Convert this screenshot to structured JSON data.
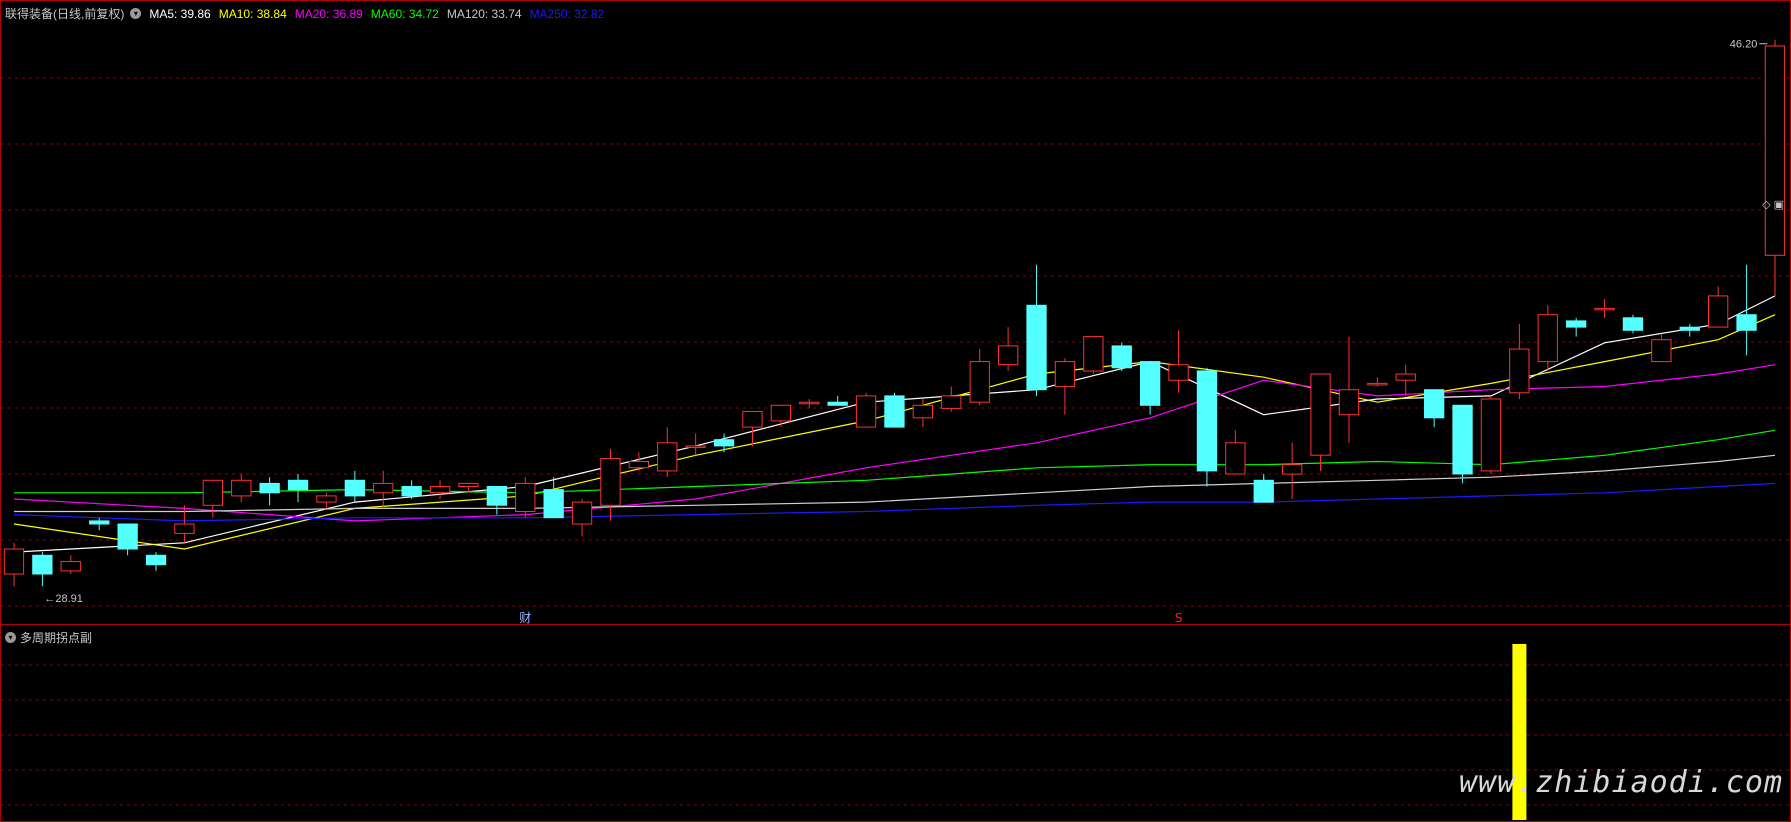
{
  "header": {
    "title": "联得装备(日线,前复权)",
    "ma_labels": [
      {
        "text": "MA5: 39.86",
        "color": "#ffffff"
      },
      {
        "text": "MA10: 38.84",
        "color": "#ffff00"
      },
      {
        "text": "MA20: 36.89",
        "color": "#ff00ff"
      },
      {
        "text": "MA60: 34.72",
        "color": "#00ff00"
      },
      {
        "text": "MA120: 33.74",
        "color": "#c8c8c8"
      },
      {
        "text": "MA250: 32.82",
        "color": "#0000ff"
      }
    ]
  },
  "annotations": {
    "high_label": "46.20",
    "low_label": "28.91",
    "marker_cai": "财",
    "marker_s": "S"
  },
  "sub": {
    "title": "多周期拐点副"
  },
  "watermark": "www.zhibiaodi.com",
  "colors": {
    "up": "#ff3030",
    "down": "#54ffff",
    "grid": "#8a0000",
    "indicator_bar": "#ffff00"
  },
  "chart_data": [
    {
      "type": "candlestick",
      "ylim": [
        28.5,
        47.0
      ],
      "up_color": "#ff3030",
      "down_color": "#54ffff",
      "candles": [
        [
          29.3,
          30.1,
          28.9,
          30.3
        ],
        [
          29.9,
          29.3,
          28.91,
          30.0
        ],
        [
          29.4,
          29.7,
          29.3,
          29.9
        ],
        [
          31.0,
          30.9,
          30.7,
          31.1
        ],
        [
          30.9,
          30.1,
          29.9,
          30.9
        ],
        [
          29.9,
          29.6,
          29.4,
          30.0
        ],
        [
          30.6,
          30.9,
          30.3,
          31.5
        ],
        [
          31.5,
          32.3,
          31.1,
          32.3
        ],
        [
          31.8,
          32.3,
          31.6,
          32.5
        ],
        [
          32.2,
          31.9,
          31.5,
          32.4
        ],
        [
          32.3,
          32.0,
          31.6,
          32.5
        ],
        [
          31.6,
          31.8,
          31.4,
          31.9
        ],
        [
          32.3,
          31.8,
          31.6,
          32.6
        ],
        [
          31.9,
          32.2,
          31.4,
          32.6
        ],
        [
          32.1,
          31.8,
          31.7,
          32.3
        ],
        [
          31.9,
          32.1,
          31.7,
          32.3
        ],
        [
          32.1,
          32.2,
          31.9,
          32.2
        ],
        [
          32.1,
          31.5,
          31.2,
          32.1
        ],
        [
          31.3,
          32.2,
          31.1,
          32.4
        ],
        [
          32.0,
          31.1,
          31.1,
          32.4
        ],
        [
          30.9,
          31.6,
          30.5,
          31.7
        ],
        [
          31.5,
          33.0,
          31.0,
          33.3
        ],
        [
          32.7,
          32.9,
          32.6,
          33.2
        ],
        [
          32.6,
          33.5,
          32.4,
          34.0
        ],
        [
          33.4,
          33.4,
          33.1,
          33.8
        ],
        [
          33.6,
          33.4,
          33.2,
          33.8
        ],
        [
          34.0,
          34.5,
          33.4,
          34.5
        ],
        [
          34.2,
          34.7,
          34.0,
          34.7
        ],
        [
          34.8,
          34.8,
          34.6,
          34.9
        ],
        [
          34.8,
          34.7,
          34.7,
          35.0
        ],
        [
          34.0,
          35.0,
          34.2,
          35.1
        ],
        [
          35.0,
          34.0,
          34.0,
          35.1
        ],
        [
          34.3,
          34.7,
          34.0,
          34.9
        ],
        [
          34.6,
          35.0,
          34.5,
          35.3
        ],
        [
          34.8,
          36.1,
          34.7,
          36.5
        ],
        [
          36.0,
          36.6,
          35.8,
          37.2
        ],
        [
          37.9,
          35.2,
          35.0,
          39.2
        ],
        [
          35.3,
          36.1,
          34.4,
          36.2
        ],
        [
          35.8,
          36.9,
          35.7,
          36.9
        ],
        [
          36.6,
          35.9,
          35.8,
          36.7
        ],
        [
          36.1,
          34.7,
          34.4,
          36.1
        ],
        [
          35.5,
          36.0,
          35.1,
          37.1
        ],
        [
          35.8,
          32.6,
          32.1,
          35.9
        ],
        [
          32.5,
          33.5,
          32.5,
          33.9
        ],
        [
          32.3,
          31.6,
          32.4,
          32.5
        ],
        [
          32.5,
          32.8,
          31.7,
          33.5
        ],
        [
          33.1,
          35.7,
          32.6,
          35.7
        ],
        [
          34.4,
          35.2,
          33.5,
          36.9
        ],
        [
          35.4,
          35.4,
          35.3,
          35.6
        ],
        [
          35.5,
          35.7,
          35.0,
          36.0
        ],
        [
          35.2,
          34.3,
          34.0,
          35.2
        ],
        [
          34.7,
          32.5,
          32.2,
          34.7
        ],
        [
          32.6,
          34.9,
          32.5,
          35.0
        ],
        [
          35.1,
          36.5,
          34.9,
          37.3
        ],
        [
          36.1,
          37.6,
          35.8,
          37.9
        ],
        [
          37.4,
          37.2,
          36.9,
          37.5
        ],
        [
          37.8,
          37.8,
          37.5,
          38.1
        ],
        [
          37.5,
          37.1,
          37.0,
          37.6
        ],
        [
          36.1,
          36.8,
          36.1,
          37.0
        ],
        [
          37.2,
          37.1,
          36.9,
          37.3
        ],
        [
          37.2,
          38.2,
          37.4,
          38.5
        ],
        [
          37.6,
          37.1,
          36.3,
          39.2
        ],
        [
          39.5,
          46.2,
          38.2,
          46.4
        ]
      ]
    },
    {
      "type": "line",
      "series": [
        {
          "name": "MA5",
          "color": "#ffffff",
          "x": [
            0,
            6,
            12,
            18,
            24,
            30,
            36,
            40,
            44,
            48,
            52,
            56,
            60,
            62
          ],
          "values": [
            30.0,
            30.3,
            31.6,
            32.1,
            33.4,
            34.8,
            35.2,
            36.1,
            34.4,
            34.9,
            35.0,
            36.7,
            37.3,
            38.2
          ]
        },
        {
          "name": "MA10",
          "color": "#ffff00",
          "x": [
            0,
            6,
            12,
            18,
            24,
            30,
            36,
            40,
            44,
            48,
            52,
            56,
            60,
            62
          ],
          "values": [
            30.9,
            30.1,
            31.4,
            31.8,
            33.1,
            34.2,
            35.7,
            36.1,
            35.6,
            34.8,
            35.4,
            36.1,
            36.8,
            37.6
          ]
        },
        {
          "name": "MA20",
          "color": "#ff00ff",
          "x": [
            0,
            6,
            12,
            18,
            24,
            30,
            36,
            40,
            44,
            48,
            52,
            56,
            60,
            62
          ],
          "values": [
            31.7,
            31.4,
            31.0,
            31.2,
            31.7,
            32.7,
            33.5,
            34.3,
            35.5,
            35.0,
            35.2,
            35.3,
            35.7,
            36.0
          ]
        },
        {
          "name": "MA60",
          "color": "#00ff00",
          "x": [
            0,
            6,
            12,
            18,
            24,
            30,
            36,
            40,
            44,
            48,
            52,
            56,
            60,
            62
          ],
          "values": [
            31.9,
            31.9,
            32.0,
            31.9,
            32.1,
            32.3,
            32.7,
            32.8,
            32.8,
            32.9,
            32.8,
            33.1,
            33.6,
            33.9
          ]
        },
        {
          "name": "MA120",
          "color": "#d0d0d0",
          "x": [
            0,
            6,
            12,
            18,
            24,
            30,
            36,
            40,
            44,
            48,
            52,
            56,
            60,
            62
          ],
          "values": [
            31.3,
            31.3,
            31.4,
            31.4,
            31.5,
            31.6,
            31.9,
            32.1,
            32.2,
            32.3,
            32.4,
            32.6,
            32.9,
            33.1
          ]
        },
        {
          "name": "MA250",
          "color": "#1a1aff",
          "x": [
            0,
            6,
            12,
            18,
            24,
            30,
            36,
            40,
            44,
            48,
            52,
            56,
            60,
            62
          ],
          "values": [
            31.2,
            31.0,
            31.1,
            31.1,
            31.2,
            31.3,
            31.5,
            31.6,
            31.6,
            31.7,
            31.8,
            31.9,
            32.1,
            32.2
          ]
        }
      ]
    },
    {
      "type": "bar",
      "x": [
        53
      ],
      "values": [
        1
      ],
      "color": "#ffff00"
    }
  ]
}
